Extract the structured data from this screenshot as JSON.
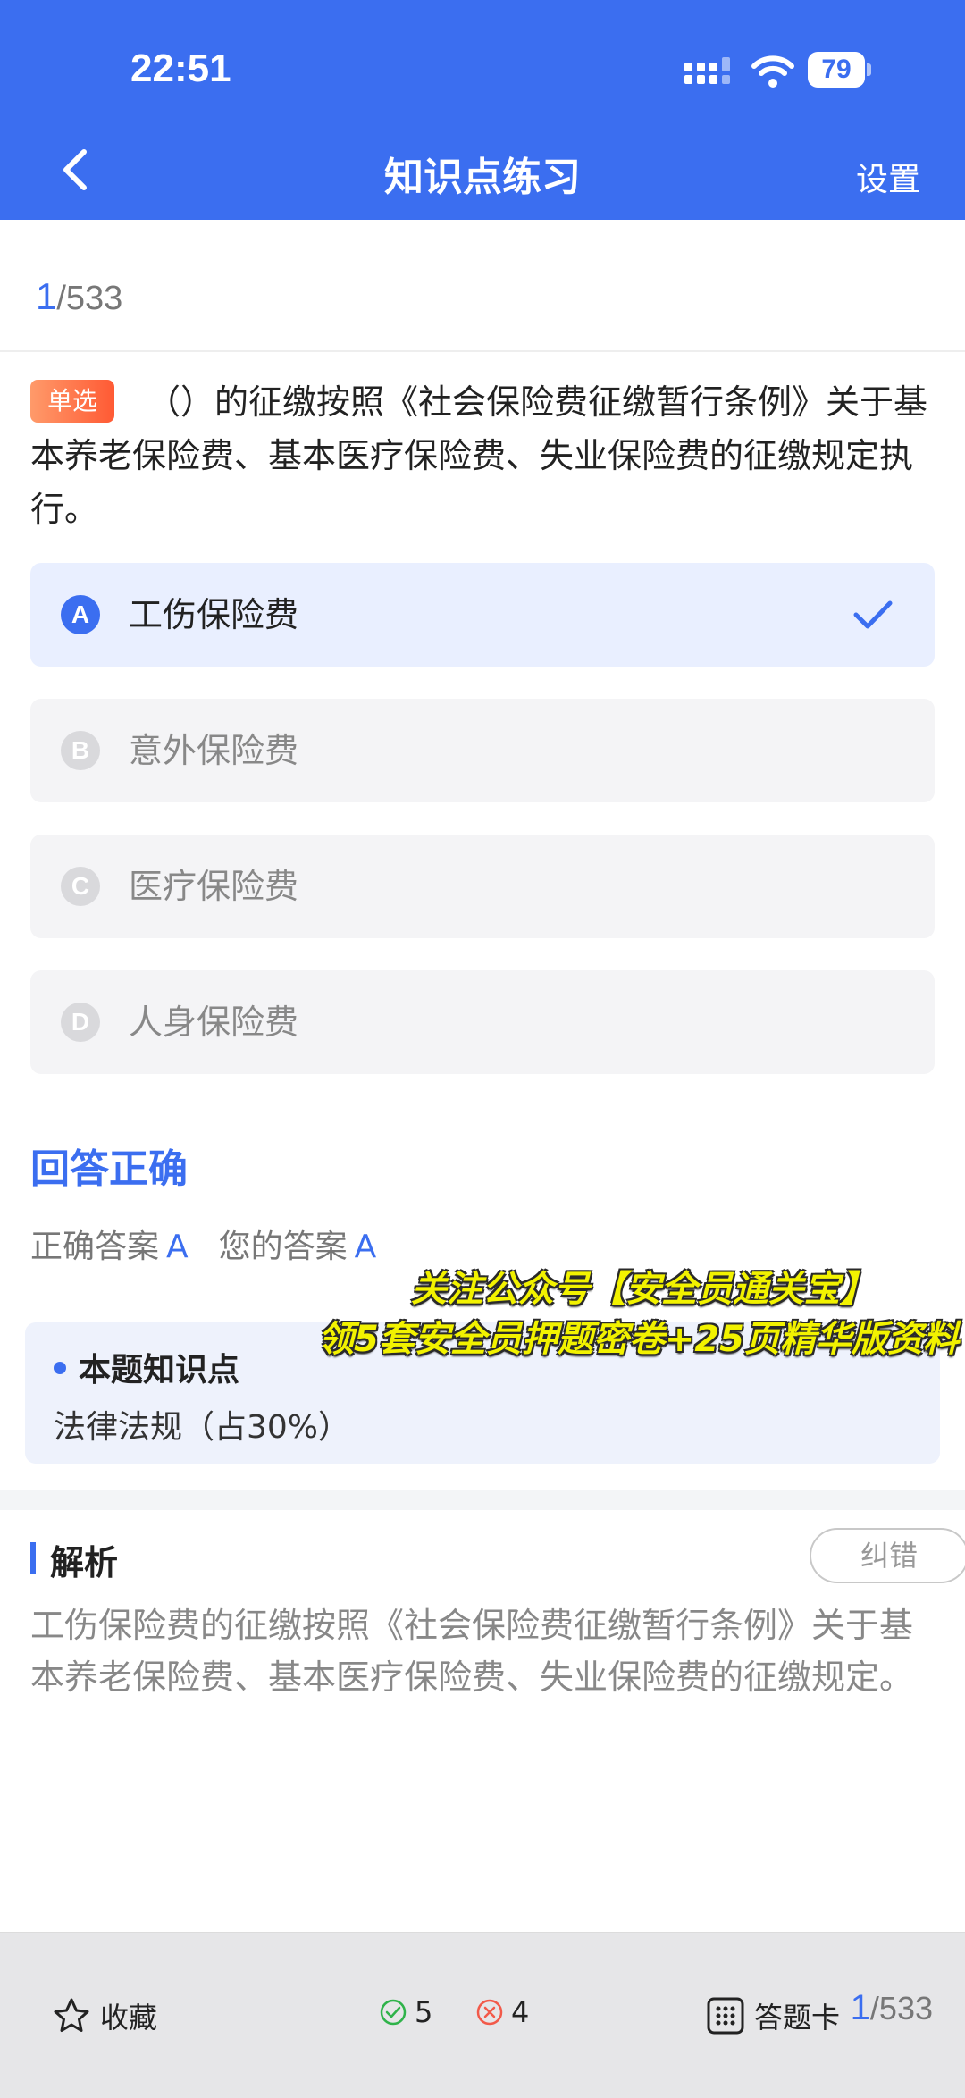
{
  "status_bar": {
    "time": "22:51",
    "battery": "79",
    "battery_level": 0.79
  },
  "header": {
    "title": "知识点练习",
    "settings_label": "设置"
  },
  "progress": {
    "current": "1",
    "total": "/533"
  },
  "question": {
    "type_badge": "单选",
    "text": "（）的征缴按照《社会保险费征缴暂行条例》关于基本养老保险费、基本医疗保险费、失业保险费的征缴规定执行。"
  },
  "options": [
    {
      "letter": "A",
      "text": "工伤保险费",
      "selected": true
    },
    {
      "letter": "B",
      "text": "意外保险费",
      "selected": false
    },
    {
      "letter": "C",
      "text": "医疗保险费",
      "selected": false
    },
    {
      "letter": "D",
      "text": "人身保险费",
      "selected": false
    }
  ],
  "result": {
    "status": "回答正确",
    "correct_label": "正确答案",
    "correct_value": "A",
    "yours_label": "您的答案",
    "yours_value": "A"
  },
  "promo": {
    "line1": "关注公众号【安全员通关宝】",
    "line2": "领5套安全员押题密卷+25页精华版资料"
  },
  "knowledge_point": {
    "title": "本题知识点",
    "text": "法律法规（占30%）"
  },
  "analysis": {
    "title": "解析",
    "report_label": "纠错",
    "text": "工伤保险费的征缴按照《社会保险费征缴暂行条例》关于基本养老保险费、基本医疗保险费、失业保险费的征缴规定。"
  },
  "bottom_bar": {
    "favorite_label": "收藏",
    "correct_count": "5",
    "wrong_count": "4",
    "answer_card_label": "答题卡",
    "progress_current": "1",
    "progress_total": "/533"
  },
  "colors": {
    "accent": "#3b6ef0",
    "correct": "#2fb34a",
    "wrong": "#f25a4a",
    "badge": "#ff6a3d"
  }
}
